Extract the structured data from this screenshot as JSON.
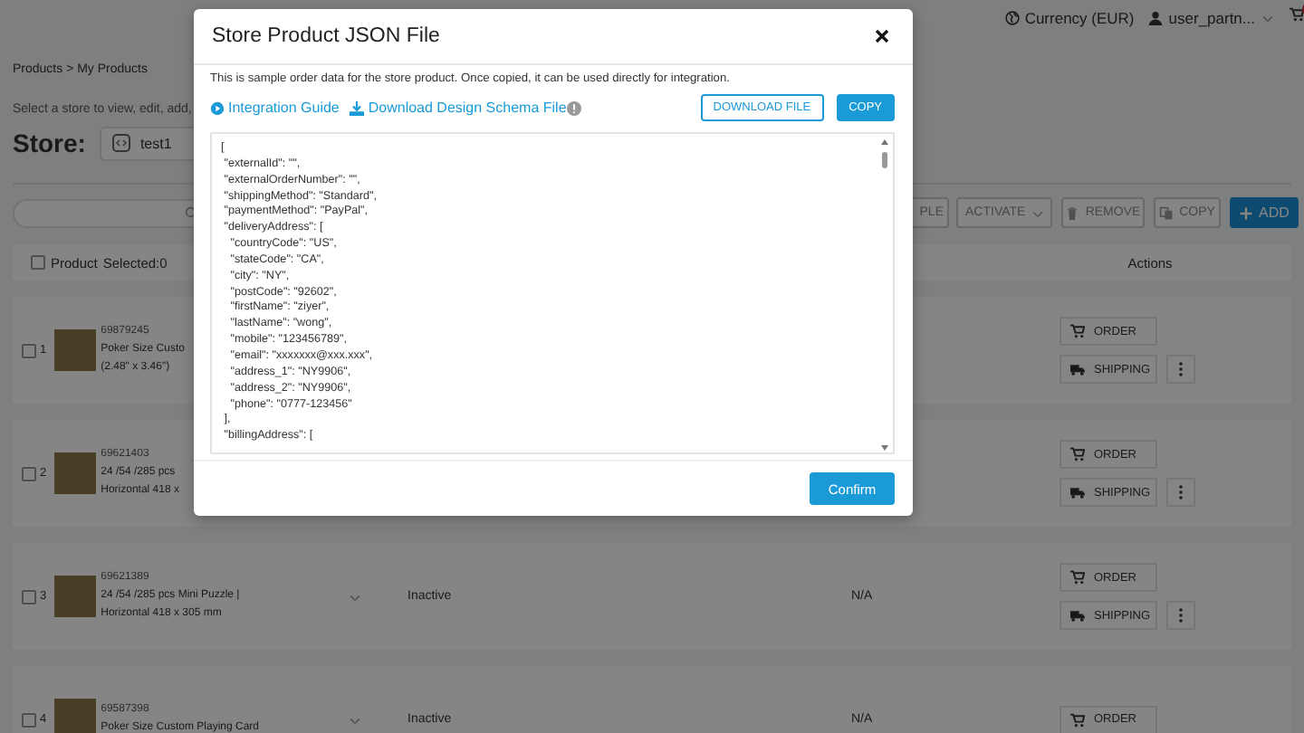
{
  "top_bar": {
    "currency": "Currency (EUR)",
    "user": "user_partn..."
  },
  "breadcrumb": "Products > My Products",
  "instruction": "Select a store to view, edit, add,",
  "store": {
    "label": "Store:",
    "value": "test1"
  },
  "toolbar": [
    {
      "kind": "plain",
      "label": "PLE"
    },
    {
      "kind": "dropdown",
      "label": "ACTIVATE"
    },
    {
      "kind": "remove",
      "label": "REMOVE"
    },
    {
      "kind": "copy",
      "label": "COPY"
    },
    {
      "kind": "add",
      "label": "ADD"
    }
  ],
  "table": {
    "header": {
      "checked": false,
      "product": "Product",
      "selected": "Selected:0",
      "actions": "Actions"
    },
    "rows": [
      {
        "index": "1",
        "checked": false,
        "id": "69879245",
        "name": [
          "Poker Size Custo",
          "(2.48\" x 3.46\")"
        ],
        "actions": [
          {
            "kind": "order",
            "label": "ORDER"
          },
          {
            "kind": "shipping",
            "label": "SHIPPING"
          }
        ]
      },
      {
        "index": "2",
        "checked": false,
        "id": "69621403",
        "name": [
          "24 /54 /285 pcs",
          "Horizontal 418 x"
        ],
        "actions": [
          {
            "kind": "order",
            "label": "ORDER"
          },
          {
            "kind": "shipping",
            "label": "SHIPPING"
          }
        ]
      },
      {
        "index": "3",
        "checked": false,
        "id": "69621389",
        "name": [
          "24 /54 /285 pcs Mini Puzzle |",
          "Horizontal 418 x 305 mm"
        ],
        "status": "Inactive",
        "column_3": "N/A",
        "actions": [
          {
            "kind": "order",
            "label": "ORDER"
          },
          {
            "kind": "shipping",
            "label": "SHIPPING"
          }
        ]
      },
      {
        "index": "4",
        "checked": false,
        "id": "69587398",
        "name": [
          "Poker Size Custom Playing Card"
        ],
        "status": "Inactive",
        "column_3": "N/A",
        "actions": [
          {
            "kind": "order",
            "label": "ORDER"
          }
        ]
      }
    ]
  },
  "modal": {
    "title": "Store Product JSON File",
    "description": "This is sample order data for the store product. Once copied, it can be used directly for integration.",
    "links": [
      {
        "kind": "guide",
        "label": "Integration Guide"
      },
      {
        "kind": "download",
        "label": "Download Design Schema File"
      }
    ],
    "buttons": [
      {
        "kind": "outline",
        "label": "DOWNLOAD FILE"
      },
      {
        "kind": "primary",
        "label": "COPY"
      }
    ],
    "code_lines": [
      "[",
      " \"externalId\": \"\",",
      " \"externalOrderNumber\": \"\",",
      " \"shippingMethod\": \"Standard\",",
      " \"paymentMethod\": \"PayPal\",",
      " \"deliveryAddress\": [",
      "   \"countryCode\": \"US\",",
      "   \"stateCode\": \"CA\",",
      "   \"city\": \"NY\",",
      "   \"postCode\": \"92602\",",
      "   \"firstName\": \"ziyer\",",
      "   \"lastName\": \"wong\",",
      "   \"mobile\": \"123456789\",",
      "   \"email\": \"xxxxxxx@xxx.xxx\",",
      "   \"address_1\": \"NY9906\",",
      "   \"address_2\": \"NY9906\",",
      "   \"phone\": \"0777-123456\"",
      " ],",
      " \"billingAddress\": ["
    ],
    "confirm": "Confirm"
  }
}
